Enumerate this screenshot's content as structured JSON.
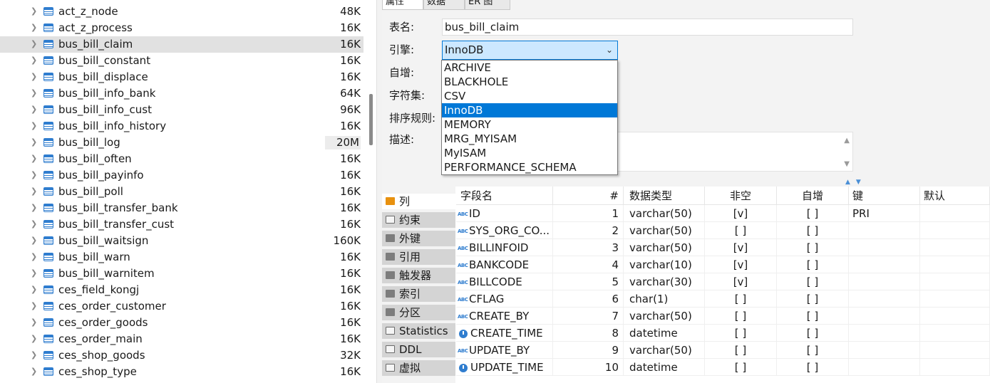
{
  "tree": {
    "items": [
      {
        "name": "act_z_node",
        "size": "48K"
      },
      {
        "name": "act_z_process",
        "size": "16K"
      },
      {
        "name": "bus_bill_claim",
        "size": "16K"
      },
      {
        "name": "bus_bill_constant",
        "size": "16K"
      },
      {
        "name": "bus_bill_displace",
        "size": "16K"
      },
      {
        "name": "bus_bill_info_bank",
        "size": "64K"
      },
      {
        "name": "bus_bill_info_cust",
        "size": "96K"
      },
      {
        "name": "bus_bill_info_history",
        "size": "16K"
      },
      {
        "name": "bus_bill_log",
        "size": "20M"
      },
      {
        "name": "bus_bill_often",
        "size": "16K"
      },
      {
        "name": "bus_bill_payinfo",
        "size": "16K"
      },
      {
        "name": "bus_bill_poll",
        "size": "16K"
      },
      {
        "name": "bus_bill_transfer_bank",
        "size": "16K"
      },
      {
        "name": "bus_bill_transfer_cust",
        "size": "16K"
      },
      {
        "name": "bus_bill_waitsign",
        "size": "160K"
      },
      {
        "name": "bus_bill_warn",
        "size": "16K"
      },
      {
        "name": "bus_bill_warnitem",
        "size": "16K"
      },
      {
        "name": "ces_field_kongj",
        "size": "16K"
      },
      {
        "name": "ces_order_customer",
        "size": "16K"
      },
      {
        "name": "ces_order_goods",
        "size": "16K"
      },
      {
        "name": "ces_order_main",
        "size": "16K"
      },
      {
        "name": "ces_shop_goods",
        "size": "32K"
      },
      {
        "name": "ces_shop_type",
        "size": "16K"
      }
    ]
  },
  "tabs": [
    {
      "label": "属性",
      "active": true
    },
    {
      "label": "数据",
      "active": false
    },
    {
      "label": "ER 图",
      "active": false
    }
  ],
  "props": {
    "table_name_label": "表名:",
    "table_name_value": "bus_bill_claim",
    "engine_label": "引擎:",
    "engine_value": "InnoDB",
    "auto_inc_label": "自增:",
    "charset_label": "字符集:",
    "collation_label": "排序规则:",
    "desc_label": "描述:"
  },
  "engine_options": [
    "ARCHIVE",
    "BLACKHOLE",
    "CSV",
    "InnoDB",
    "MEMORY",
    "MRG_MYISAM",
    "MyISAM",
    "PERFORMANCE_SCHEMA"
  ],
  "engine_selected": "InnoDB",
  "side_tabs": [
    {
      "label": "列",
      "icon": "columns-icon",
      "active": true
    },
    {
      "label": "约束",
      "icon": "constraint-icon",
      "active": false
    },
    {
      "label": "外键",
      "icon": "folder-icon",
      "active": false
    },
    {
      "label": "引用",
      "icon": "folder-icon",
      "active": false
    },
    {
      "label": "触发器",
      "icon": "folder-icon",
      "active": false
    },
    {
      "label": "索引",
      "icon": "folder-icon",
      "active": false
    },
    {
      "label": "分区",
      "icon": "folder-icon",
      "active": false
    },
    {
      "label": "Statistics",
      "icon": "info-icon",
      "active": false
    },
    {
      "label": "DDL",
      "icon": "ddl-icon",
      "active": false
    },
    {
      "label": "虚拟",
      "icon": "virtual-icon",
      "active": false
    }
  ],
  "grid": {
    "headers": {
      "name": "字段名",
      "num": "#",
      "type": "数据类型",
      "notnull": "非空",
      "autoinc": "自增",
      "key": "键",
      "default": "默认"
    },
    "rows": [
      {
        "icon": "key-text",
        "name": "ID",
        "num": "1",
        "type": "varchar(50)",
        "notnull": "[v]",
        "autoinc": "[ ]",
        "key": "PRI"
      },
      {
        "icon": "text",
        "name": "SYS_ORG_CO...",
        "num": "2",
        "type": "varchar(50)",
        "notnull": "[ ]",
        "autoinc": "[ ]",
        "key": ""
      },
      {
        "icon": "text",
        "name": "BILLINFOID",
        "num": "3",
        "type": "varchar(50)",
        "notnull": "[v]",
        "autoinc": "[ ]",
        "key": ""
      },
      {
        "icon": "text",
        "name": "BANKCODE",
        "num": "4",
        "type": "varchar(10)",
        "notnull": "[v]",
        "autoinc": "[ ]",
        "key": ""
      },
      {
        "icon": "text",
        "name": "BILLCODE",
        "num": "5",
        "type": "varchar(30)",
        "notnull": "[v]",
        "autoinc": "[ ]",
        "key": ""
      },
      {
        "icon": "text",
        "name": "CFLAG",
        "num": "6",
        "type": "char(1)",
        "notnull": "[ ]",
        "autoinc": "[ ]",
        "key": ""
      },
      {
        "icon": "text",
        "name": "CREATE_BY",
        "num": "7",
        "type": "varchar(50)",
        "notnull": "[ ]",
        "autoinc": "[ ]",
        "key": ""
      },
      {
        "icon": "clock",
        "name": "CREATE_TIME",
        "num": "8",
        "type": "datetime",
        "notnull": "[ ]",
        "autoinc": "[ ]",
        "key": ""
      },
      {
        "icon": "text",
        "name": "UPDATE_BY",
        "num": "9",
        "type": "varchar(50)",
        "notnull": "[ ]",
        "autoinc": "[ ]",
        "key": ""
      },
      {
        "icon": "clock",
        "name": "UPDATE_TIME",
        "num": "10",
        "type": "datetime",
        "notnull": "[ ]",
        "autoinc": "[ ]",
        "key": ""
      }
    ]
  },
  "colors": {
    "accent": "#0078d7",
    "table_icon": "#2f7dcf",
    "folder": "#7d7d7d",
    "columns_icon": "#e8910f"
  }
}
